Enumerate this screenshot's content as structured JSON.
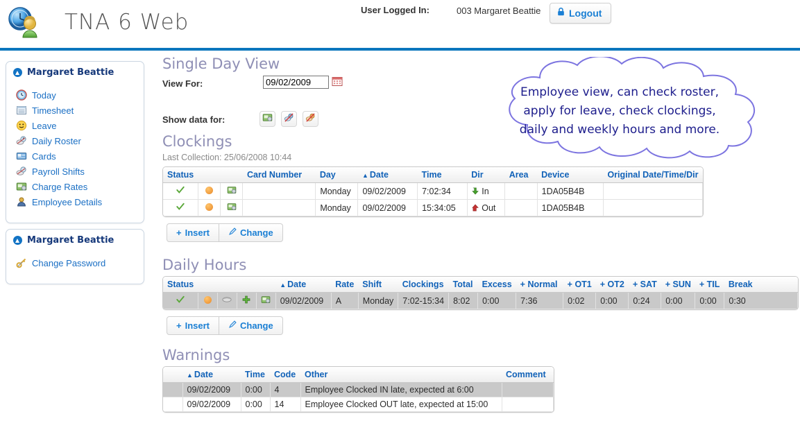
{
  "header": {
    "app_title": "TNA 6 Web",
    "user_logged_label": "User Logged In:",
    "user_name": "003 Margaret Beattie",
    "logout_label": "Logout",
    "accent_color": "#0b76bd",
    "link_color": "#1a6fc4"
  },
  "sidebar": {
    "panel1": {
      "title": "Margaret Beattie",
      "items": [
        {
          "label": "Today",
          "icon": "clock-icon"
        },
        {
          "label": "Timesheet",
          "icon": "timesheet-icon"
        },
        {
          "label": "Leave",
          "icon": "smiley-icon"
        },
        {
          "label": "Daily Roster",
          "icon": "roster-icon"
        },
        {
          "label": "Cards",
          "icon": "cards-icon"
        },
        {
          "label": "Payroll Shifts",
          "icon": "payroll-shifts-icon"
        },
        {
          "label": "Charge Rates",
          "icon": "charge-rates-icon"
        },
        {
          "label": "Employee Details",
          "icon": "employee-details-icon"
        }
      ]
    },
    "panel2": {
      "title": "Margaret Beattie",
      "items": [
        {
          "label": "Change Password",
          "icon": "key-icon"
        }
      ]
    }
  },
  "main": {
    "page_title": "Single Day View",
    "view_for_label": "View For:",
    "view_for_value": "09/02/2009",
    "calendar_icon": "calendar-icon",
    "show_data_label": "Show data for:",
    "show_data_icons": [
      "department-icon",
      "disabled-blue-icon",
      "disabled-red-icon"
    ],
    "clockings": {
      "title": "Clockings",
      "last_collection": "Last Collection: 25/06/2008 10:44",
      "columns": [
        "Status",
        "",
        "",
        "Card Number",
        "Day",
        "Date",
        "Time",
        "Dir",
        "Area",
        "Device",
        "Original Date/Time/Dir"
      ],
      "sorted_column": "Date",
      "rows": [
        {
          "card_number": "",
          "day": "Monday",
          "date": "09/02/2009",
          "time": "7:02:34",
          "dir": "In",
          "area": "",
          "device": "1DA05B4B",
          "original": ""
        },
        {
          "card_number": "",
          "day": "Monday",
          "date": "09/02/2009",
          "time": "15:34:05",
          "dir": "Out",
          "area": "",
          "device": "1DA05B4B",
          "original": ""
        }
      ],
      "buttons": [
        {
          "label": "Insert",
          "icon": "plus-icon"
        },
        {
          "label": "Change",
          "icon": "pencil-icon"
        }
      ]
    },
    "daily_hours": {
      "title": "Daily Hours",
      "columns": [
        "Status",
        "",
        "",
        "",
        "",
        "Date",
        "Rate",
        "Shift",
        "Clockings",
        "Total",
        "Excess",
        "+ Normal",
        "+ OT1",
        "+ OT2",
        "+ SAT",
        "+ SUN",
        "+ TIL",
        "Break"
      ],
      "sorted_column": "Date",
      "rows": [
        {
          "date": "09/02/2009",
          "rate": "A",
          "shift": "Monday",
          "clockings": "7:02-15:34",
          "total": "8:02",
          "excess": "0:00",
          "normal": "7:36",
          "ot1": "0:02",
          "ot2": "0:00",
          "sat": "0:24",
          "sun": "0:00",
          "til": "0:00",
          "break": "0:30"
        }
      ],
      "buttons": [
        {
          "label": "Insert",
          "icon": "plus-icon"
        },
        {
          "label": "Change",
          "icon": "pencil-icon"
        }
      ]
    },
    "warnings": {
      "title": "Warnings",
      "columns": [
        "",
        "Date",
        "Time",
        "Code",
        "Other",
        "Comment"
      ],
      "sorted_column": "Date",
      "rows": [
        {
          "date": "09/02/2009",
          "time": "0:00",
          "code": "4",
          "other": "Employee Clocked IN late, expected at 6:00",
          "comment": ""
        },
        {
          "date": "09/02/2009",
          "time": "0:00",
          "code": "14",
          "other": "Employee Clocked OUT late, expected at 15:00",
          "comment": ""
        }
      ]
    }
  },
  "callout": {
    "line1": "Employee view, can check roster,",
    "line2": "apply for leave, check clockings,",
    "line3": "daily and weekly hours and more.",
    "outline_color": "#7c74e0",
    "text_color": "#1d1d8c"
  }
}
